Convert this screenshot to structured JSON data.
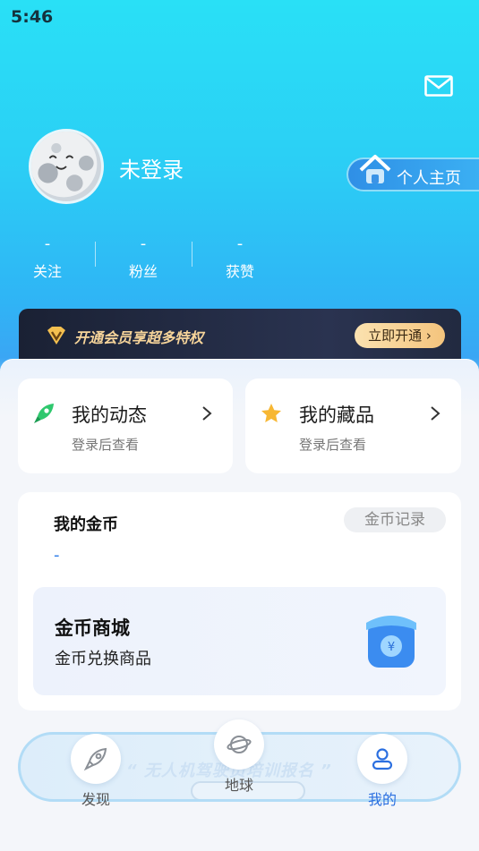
{
  "status": {
    "time": "5:46"
  },
  "header": {
    "mail_icon": "envelope-icon",
    "username": "未登录",
    "profile_button": "个人主页",
    "stats": [
      {
        "value": "-",
        "label": "关注"
      },
      {
        "value": "-",
        "label": "粉丝"
      },
      {
        "value": "-",
        "label": "获赞"
      }
    ]
  },
  "vip": {
    "text": "开通会员享超多特权",
    "button": "立即开通"
  },
  "cards": {
    "activity": {
      "title": "我的动态",
      "subtitle": "登录后查看",
      "icon": "rocket-icon"
    },
    "collection": {
      "title": "我的藏品",
      "subtitle": "登录后查看",
      "icon": "star-icon"
    }
  },
  "coins": {
    "title": "我的金币",
    "value": "-",
    "records_button": "金币记录",
    "mall_title": "金币商城",
    "mall_subtitle": "金币兑换商品"
  },
  "promo": {
    "text": "“ 无人机驾驶员培训报名 ”"
  },
  "tabs": [
    {
      "label": "发现",
      "icon": "rocket-icon",
      "active": false
    },
    {
      "label": "地球",
      "icon": "planet-icon",
      "active": false
    },
    {
      "label": "我的",
      "icon": "user-icon",
      "active": true
    }
  ],
  "colors": {
    "accent": "#2b6fe0",
    "header_top": "#29e0f6",
    "vip_gold": "#f6d49a"
  }
}
